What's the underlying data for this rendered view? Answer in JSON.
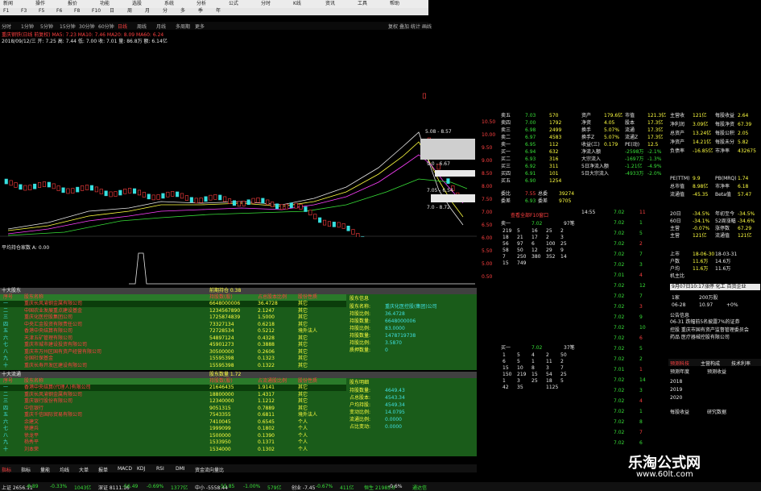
{
  "top_menu": [
    "新闻",
    "操作",
    "报价",
    "功能",
    "选股",
    "系统",
    "分析",
    "公式",
    "分时",
    "K线",
    "资讯",
    "工具",
    "帮助"
  ],
  "top_icons": [
    "F1",
    "F3",
    "F5",
    "F6",
    "F8",
    "F10",
    "日",
    "周",
    "月",
    "分",
    "多",
    "季",
    "年"
  ],
  "period_tabs": [
    "分时",
    "1分钟",
    "5分钟",
    "15分钟",
    "30分钟",
    "60分钟",
    "日线",
    "周线",
    "月线",
    "多周期",
    "更多"
  ],
  "right_tabs": [
    "复权",
    "叠加",
    "统计",
    "画线"
  ],
  "chart_title": "重庆钢铁(日线 前复权)  MA5: 7.23  MA10: 7.46  MA20: 8.09  MA60: 6.24",
  "chart_sub": "2018/09/12/三  开: 7.25  高: 7.44  低: 7.00  收: 7.01  量: 86.8万  额: 6.14亿",
  "indicator_title": "平均持仓家数  A: 0.00",
  "price_scale": [
    "10.50",
    "10.00",
    "9.50",
    "9.00",
    "8.50",
    "8.00",
    "7.50",
    "7.00",
    "6.50",
    "6.00",
    "5.50",
    "5.00",
    "0.50"
  ],
  "chips_labels": [
    "5.08 - 8.57",
    "9.0 - 6.67",
    "7.05 - 6.54",
    "7.0 - 8.72"
  ],
  "panel1": {
    "title": "十大股东",
    "badge": "前期持仓 0.38",
    "headers": [
      "序号",
      "股东名称",
      "持股数(股)",
      "占总股本比例",
      "股份性质"
    ],
    "rows": [
      [
        "一",
        "重庆长风渝钢金属有限公司",
        "6648000006",
        "36.4728",
        "其它"
      ],
      [
        "二",
        "中国农业发展重点建设基金",
        "1234567890",
        "2.1247",
        "其它"
      ],
      [
        "三",
        "重庆化医控股集团公司",
        "1725874839",
        "1.5000",
        "其它"
      ],
      [
        "四",
        "中央汇金投资有限责任公司",
        "73327134",
        "0.6218",
        "其它"
      ],
      [
        "五",
        "香港中央结算有限公司",
        "72728534",
        "0.5212",
        "境外法人"
      ],
      [
        "六",
        "天津五矿管理有限公司",
        "54897124",
        "0.4328",
        "其它"
      ],
      [
        "七",
        "重庆市城市建设投资有限公司",
        "45901273",
        "0.3888",
        "其它"
      ],
      [
        "八",
        "重庆市万州区国有资产经营有限公司",
        "30500000",
        "0.2606",
        "其它"
      ],
      [
        "九",
        "全国社保基金",
        "15595398",
        "0.1323",
        "其它"
      ],
      [
        "十",
        "重庆长寿开发区建设有限公司",
        "15595398",
        "0.1322",
        "其它"
      ]
    ],
    "info_title": "股东信息",
    "info": [
      [
        "股东名称:",
        "重庆化医控股(集团)公司"
      ],
      [
        "持股比例:",
        "36.4728"
      ],
      [
        "持股数量:",
        "6648000006"
      ],
      [
        "持股比例:",
        "83.0000"
      ],
      [
        "持股数量:",
        "1478719738"
      ],
      [
        "持股比例:",
        "3.5870"
      ],
      [
        "质押数量:",
        "0"
      ]
    ]
  },
  "panel2": {
    "title": "十大流通",
    "badge": "股东数量 1.72",
    "headers": [
      "序号",
      "股东名称",
      "持股数(股)",
      "占流通股比例",
      "股份性质"
    ],
    "rows": [
      [
        "一",
        "香港中央结算(代理人)有限公司",
        "21646435",
        "1.9141",
        "其它"
      ],
      [
        "二",
        "重庆长风渝钢金属有限公司",
        "18800000",
        "1.4317",
        "其它"
      ],
      [
        "三",
        "重庆银行股份有限公司",
        "12340000",
        "1.1212",
        "其它"
      ],
      [
        "四",
        "中信银行",
        "9051315",
        "0.7889",
        "其它"
      ],
      [
        "五",
        "重庆千信国际贸易有限公司",
        "7543355",
        "0.6811",
        "境外法人"
      ],
      [
        "六",
        "余建文",
        "7410045",
        "0.6545",
        "个人"
      ],
      [
        "七",
        "徐建兵",
        "1999099",
        "0.1802",
        "个人"
      ],
      [
        "八",
        "徐龙平",
        "1500000",
        "0.1390",
        "个人"
      ],
      [
        "九",
        "杨秀平",
        "1533950",
        "0.1371",
        "个人"
      ],
      [
        "十",
        "刘本荣",
        "1534000",
        "0.1302",
        "个人"
      ]
    ],
    "info_title": "股东明细",
    "info": [
      [
        "持股数量:",
        "4649.43"
      ],
      [
        "占总股本:",
        "4543.34"
      ],
      [
        "户均持股:",
        "4549.34"
      ],
      [
        "变动比例:",
        "14.0795"
      ],
      [
        "流通比例:",
        "0.0000"
      ],
      [
        "占比变动:",
        "0.0000"
      ]
    ]
  },
  "bottom_tabs": [
    "指标",
    "指标",
    "量能",
    "均线",
    "大单",
    "报单",
    "MACD",
    "KDJ",
    "RSI",
    "DMI",
    "资金流向",
    "量比"
  ],
  "quotes": {
    "sell": [
      [
        "卖五",
        "7.03",
        "570"
      ],
      [
        "卖四",
        "7.00",
        "1792"
      ],
      [
        "卖三",
        "6.98",
        "2499"
      ],
      [
        "卖二",
        "6.97",
        "4583"
      ],
      [
        "卖一",
        "6.95",
        "112"
      ],
      [
        "买一",
        "6.94",
        "632"
      ],
      [
        "买二",
        "6.93",
        "316"
      ],
      [
        "买三",
        "6.92",
        "311"
      ],
      [
        "买四",
        "6.91",
        "101"
      ],
      [
        "买五",
        "6.90",
        "1254"
      ]
    ],
    "wei": [
      "委比",
      "7.55",
      "总委",
      "39274"
    ],
    "buy2": [
      "委差",
      "6.93",
      "委差",
      "9705"
    ]
  },
  "fund": [
    [
      "资产",
      "179.6亿",
      "市值",
      "121.3亿"
    ],
    [
      "净资",
      "4.05",
      "股本",
      "17.3亿"
    ],
    [
      "换手",
      "5.07%",
      "流通",
      "17.3亿"
    ],
    [
      "换手Z",
      "5.07%",
      "流通Z",
      "17.3亿"
    ],
    [
      "收益(三)",
      "0.179",
      "PE(动)",
      "12.5"
    ],
    [
      "净流入额",
      "",
      "-2598万",
      "-2.1%"
    ],
    [
      "大宗流入",
      "",
      "-1697万",
      "-1.3%"
    ],
    [
      "5日净流入额",
      "",
      "-1.21亿",
      "-4.9%"
    ],
    [
      "5日大宗流入",
      "",
      "-4933万",
      "-2.0%"
    ]
  ],
  "right_fund": [
    [
      "主营收",
      "121亿",
      "每股收益",
      "2.64"
    ],
    [
      "净利润",
      "3.09亿",
      "每股净资",
      "67.39"
    ],
    [
      "总资产",
      "13.24亿",
      "每股公积",
      "2.05"
    ],
    [
      "净资产",
      "14.21亿",
      "每股未分",
      "5.82"
    ],
    [
      "负债率",
      "-16.85亿",
      "市净率",
      "432675"
    ]
  ],
  "notice_title": "查看全部F10窗口",
  "order_book_head": [
    "卖一",
    "",
    "7.02",
    "97笔"
  ],
  "order_rows": [
    [
      "219",
      "5",
      "16",
      "25",
      "2"
    ],
    [
      "18",
      "21",
      "17",
      "2",
      "3"
    ],
    [
      "56",
      "97",
      "6",
      "100",
      "25"
    ],
    [
      "58",
      "50",
      "12",
      "29",
      "9"
    ],
    [
      "7",
      "250",
      "380",
      "352",
      "14"
    ],
    [
      "15",
      "749",
      "",
      "",
      ""
    ]
  ],
  "order_book_head2": [
    "买一",
    "",
    "7.02",
    "37笔"
  ],
  "order_rows2": [
    [
      "1",
      "5",
      "4",
      "2",
      "50"
    ],
    [
      "6",
      "5",
      "1",
      "11",
      "2"
    ],
    [
      "15",
      "10",
      "8",
      "3",
      "7"
    ],
    [
      "150",
      "219",
      "15",
      "54",
      "25"
    ],
    [
      "1",
      "3",
      "25",
      "18",
      "5"
    ],
    [
      "42",
      "35",
      "",
      "1125",
      ""
    ]
  ],
  "ticks": [
    [
      "14:55",
      "7.02",
      "11"
    ],
    [
      "",
      "7.02",
      "1"
    ],
    [
      "",
      "7.02",
      "5"
    ],
    [
      "",
      "7.02",
      "2"
    ],
    [
      "",
      "7.02",
      "7"
    ],
    [
      "",
      "7.02",
      "3"
    ],
    [
      "",
      "7.01",
      "4"
    ],
    [
      "",
      "7.02",
      "12"
    ],
    [
      "",
      "7.02",
      "7"
    ],
    [
      "",
      "7.02",
      "3"
    ],
    [
      "",
      "7.02",
      "9"
    ],
    [
      "",
      "7.02",
      "10"
    ],
    [
      "",
      "7.02",
      "6"
    ],
    [
      "",
      "7.02",
      "5"
    ],
    [
      "",
      "7.02",
      "2"
    ],
    [
      "",
      "7.01",
      "1"
    ],
    [
      "",
      "7.02",
      "14"
    ],
    [
      "",
      "7.02",
      "3"
    ],
    [
      "",
      "7.02",
      "4"
    ],
    [
      "",
      "7.02",
      "1"
    ],
    [
      "",
      "7.02",
      "8"
    ],
    [
      "",
      "7.02",
      "7"
    ],
    [
      "",
      "7.02",
      "6"
    ]
  ],
  "right_stats": [
    [
      "PE(TTM)",
      "9.9",
      "PB(MRQ)",
      "1.74"
    ],
    [
      "总市值",
      "8.98亿",
      "市净率",
      "6.18"
    ],
    [
      "流通值",
      "-45.35",
      "Beta值",
      "57.47"
    ]
  ],
  "right_days": [
    [
      "20日",
      "-34.5%",
      "年初至今",
      "-34.5%"
    ],
    [
      "60日",
      "-34.1%",
      "52周涨幅",
      "-34.6%"
    ],
    [
      "主营",
      "-0.07%",
      "涨停数",
      "67.29"
    ],
    [
      "主营",
      "121亿",
      "流通值",
      "121亿"
    ]
  ],
  "right_dates": [
    [
      "上市",
      "18-06-30",
      "18-03-31"
    ],
    [
      "户数",
      "11.6万",
      "14.6万"
    ],
    [
      "户均",
      "11.6万",
      "11.6万"
    ],
    [
      "机主比",
      "",
      "",
      ""
    ]
  ],
  "industry_line": "9月07日10:17涨停 化工 百货企业",
  "right_misc": [
    [
      "1家",
      "200万股"
    ],
    [
      "06-28",
      "10.97",
      "+0%"
    ]
  ],
  "news_head": "公告信息",
  "news": [
    "06-31  跌幅前5名披露7%的证券",
    "控股  重庆市国有资产监督管理委员会",
    "药品  医疗器械控股有限公司"
  ],
  "bottom_tabs_right": [
    "预测科技",
    "主营构成",
    "技术利率"
  ],
  "forecast_head": [
    "预测年度",
    "预测收益"
  ],
  "forecast": [
    [
      "2018",
      ""
    ],
    [
      "2019",
      ""
    ],
    [
      "2020",
      ""
    ]
  ],
  "forecast_foot": [
    "每股收益",
    "研究数据"
  ],
  "status_items": [
    "上证 2656.11",
    "-8.89",
    "-0.33%",
    "1043亿",
    "深证 8111.16",
    "-56.49",
    "-0.69%",
    "1377亿",
    "中小 -5558.44",
    "-55.85",
    "-1.00%",
    "579亿",
    "创业 -7.45",
    "-0.67%",
    "411亿",
    "恒生 21985.0",
    "-0.6%",
    "通达信"
  ],
  "watermark_cn": "乐淘公式网",
  "watermark_url": "www.60lt.com",
  "colors": {
    "up": "#ff4040",
    "down": "#38e038",
    "panel_bg": "#1a5c1a",
    "accent_yellow": "#ffff40"
  }
}
